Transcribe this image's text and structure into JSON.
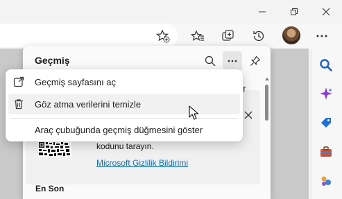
{
  "window": {
    "controls": [
      {
        "name": "minimize-button",
        "icon": "minimize-icon"
      },
      {
        "name": "restore-button",
        "icon": "restore-icon"
      },
      {
        "name": "close-window-button",
        "icon": "close-icon"
      }
    ]
  },
  "toolbar": {
    "icons": [
      "add-favorite-icon",
      "favorites-icon",
      "collections-icon",
      "history-icon",
      "profile-avatar",
      "more-icon"
    ]
  },
  "history_panel": {
    "title": "Geçmiş",
    "partial_tab_text": "er",
    "card": {
      "scan_text": "kodunu tarayın.",
      "privacy_link": "Microsoft Gizlilik Bildirimi"
    },
    "section_title": "En Son"
  },
  "menu": {
    "items": [
      {
        "label": "Geçmiş sayfasını aç",
        "icon": "open-external-icon"
      },
      {
        "label": "Göz atma verilerini temizle",
        "icon": "trash-icon"
      },
      {
        "label": "Araç çubuğunda geçmiş düğmesini göster",
        "icon": ""
      }
    ]
  },
  "sidebar": {
    "icons": [
      "search-icon",
      "copilot-icon",
      "shopping-tag-icon",
      "tools-icon",
      "games-icon"
    ]
  },
  "colors": {
    "link": "#0f6cbd",
    "search": "#1a5fcc",
    "copilot": "#8b3bd9",
    "tag": "#1d6fd9",
    "tools": "#d64e2f"
  }
}
